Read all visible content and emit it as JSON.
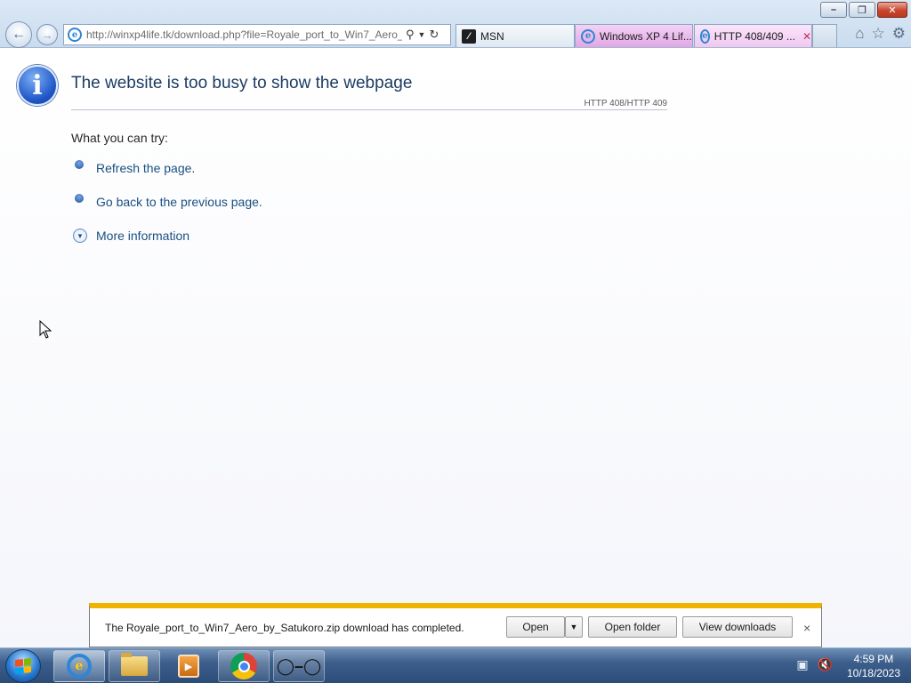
{
  "browser": {
    "address_url_host": "http://winxp4life.tk",
    "address_url_path": "/download.php?file=Royale_port_to_Win7_Aero_",
    "tabs": [
      {
        "label": "MSN"
      },
      {
        "label": "Windows XP 4 Lif..."
      },
      {
        "label": "HTTP 408/409 ..."
      }
    ]
  },
  "page": {
    "title": "The website is too busy to show the webpage",
    "error_code": "HTTP 408/HTTP 409",
    "try_label": "What you can try:",
    "suggestions": [
      {
        "label": "Refresh the page."
      },
      {
        "label": "Go back to the previous page."
      }
    ],
    "more_info": "More information"
  },
  "download_bar": {
    "message": "The Royale_port_to_Win7_Aero_by_Satukoro.zip download has completed.",
    "open_label": "Open",
    "open_folder_label": "Open folder",
    "view_downloads_label": "View downloads",
    "close_glyph": "×"
  },
  "taskbar": {
    "time": "4:59 PM",
    "date": "10/18/2023"
  },
  "colors": {
    "accent_notify": "#f0b400",
    "link": "#1a4f80",
    "title": "#1c3c63"
  }
}
